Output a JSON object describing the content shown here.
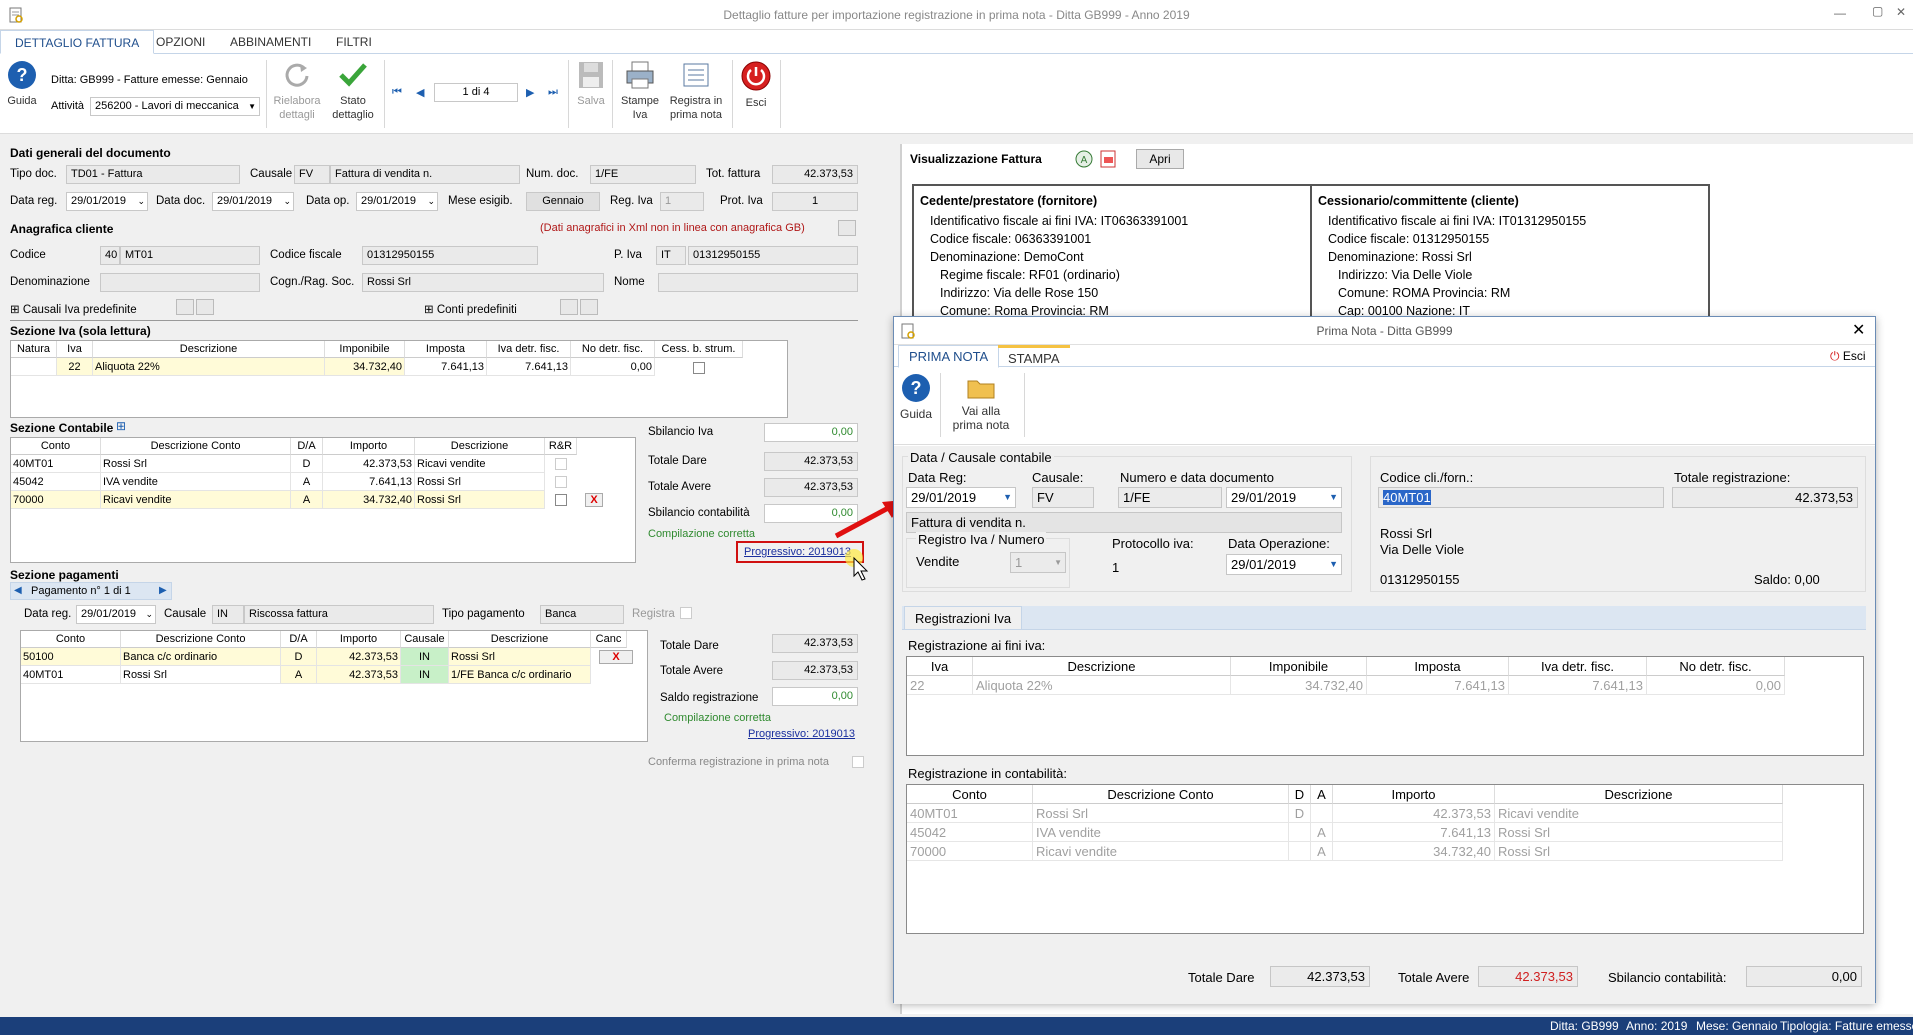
{
  "window": {
    "title": "Dettaglio fatture per importazione registrazione in prima nota - Ditta GB999 - Anno 2019",
    "min": "—",
    "max": "▢",
    "close": "✕"
  },
  "tabs": [
    "DETTAGLIO FATTURA",
    "OPZIONI",
    "ABBINAMENTI",
    "FILTRI"
  ],
  "ribbon": {
    "guida": "Guida",
    "ditta": "Ditta: GB999 - Fatture emesse: Gennaio",
    "attivita_label": "Attività",
    "attivita": "256200 - Lavori di meccanica",
    "rielabora": "Rielabora",
    "dettagli": "dettagli",
    "stato": "Stato",
    "dettaglio": "dettaglio",
    "page": "1 di 4",
    "salva": "Salva",
    "stampe": "Stampe",
    "iva": "Iva",
    "registra": "Registra in",
    "prima_nota": "prima nota",
    "esci": "Esci"
  },
  "dati": {
    "title": "Dati generali del documento",
    "tipo_doc_l": "Tipo doc.",
    "tipo_doc": "TD01 - Fattura",
    "causale_l": "Causale",
    "causale_code": "FV",
    "causale_desc": "Fattura di vendita n.",
    "num_doc_l": "Num. doc.",
    "num_doc": "1/FE",
    "tot_l": "Tot. fattura",
    "tot": "42.373,53",
    "data_reg_l": "Data reg.",
    "data_reg": "29/01/2019",
    "data_doc_l": "Data doc.",
    "data_doc": "29/01/2019",
    "data_op_l": "Data op.",
    "data_op": "29/01/2019",
    "mese_l": "Mese esigib.",
    "mese": "Gennaio",
    "reg_iva_l": "Reg. Iva",
    "reg_iva": "1",
    "prot_l": "Prot. Iva",
    "prot": "1"
  },
  "anagrafica": {
    "title": "Anagrafica cliente",
    "note": "(Dati anagrafici in Xml non in linea con anagrafica GB)",
    "codice_l": "Codice",
    "codice_n": "40",
    "codice": "MT01",
    "cf_l": "Codice fiscale",
    "cf": "01312950155",
    "piva_l": "P. Iva",
    "piva_c": "IT",
    "piva": "01312950155",
    "denom_l": "Denominazione",
    "cogn_l": "Cogn./Rag. Soc.",
    "cogn": "Rossi Srl",
    "nome_l": "Nome",
    "causali": "Causali Iva predefinite",
    "conti": "Conti predefiniti"
  },
  "iva": {
    "title": "Sezione Iva (sola lettura)",
    "headers": [
      "Natura",
      "Iva",
      "Descrizione",
      "Imponibile",
      "Imposta",
      "Iva detr. fisc.",
      "No detr. fisc.",
      "Cess. b. strum."
    ],
    "row": [
      "",
      "22",
      "Aliquota 22%",
      "34.732,40",
      "7.641,13",
      "7.641,13",
      "0,00"
    ]
  },
  "contabile": {
    "title": "Sezione Contabile",
    "plus": "⊞",
    "headers": [
      "Conto",
      "Descrizione Conto",
      "D/A",
      "Importo",
      "Descrizione",
      "R&R"
    ],
    "rows": [
      [
        "40MT01",
        "Rossi Srl",
        "D",
        "42.373,53",
        "Ricavi vendite"
      ],
      [
        "45042",
        "IVA vendite",
        "A",
        "7.641,13",
        "Rossi Srl"
      ],
      [
        "70000",
        "Ricavi vendite",
        "A",
        "34.732,40",
        "Rossi Srl"
      ]
    ],
    "sb_iva_l": "Sbilancio Iva",
    "sb_iva": "0,00",
    "tot_dare_l": "Totale Dare",
    "tot_dare": "42.373,53",
    "tot_avere_l": "Totale Avere",
    "tot_avere": "42.373,53",
    "sb_cont_l": "Sbilancio contabilità",
    "sb_cont": "0,00",
    "ok": "Compilazione corretta",
    "progressivo": "Progressivo: 2019013"
  },
  "pagamenti": {
    "title": "Sezione pagamenti",
    "nav": "Pagamento n° 1 di 1",
    "data_l": "Data reg.",
    "data": "29/01/2019",
    "causale_l": "Causale",
    "causale_code": "IN",
    "causale_desc": "Riscossa fattura",
    "tipo_l": "Tipo pagamento",
    "tipo": "Banca",
    "registra": "Registra",
    "headers": [
      "Conto",
      "Descrizione Conto",
      "D/A",
      "Importo",
      "Causale",
      "Descrizione",
      "Canc"
    ],
    "rows": [
      [
        "50100",
        "Banca c/c ordinario",
        "D",
        "42.373,53",
        "IN",
        "Rossi Srl"
      ],
      [
        "40MT01",
        "Rossi Srl",
        "A",
        "42.373,53",
        "IN",
        "1/FE Banca c/c ordinario"
      ]
    ],
    "tot_dare_l": "Totale Dare",
    "tot_dare": "42.373,53",
    "tot_avere_l": "Totale Avere",
    "tot_avere": "42.373,53",
    "saldo_l": "Saldo registrazione",
    "saldo": "0,00",
    "ok": "Compilazione corretta",
    "progressivo": "Progressivo: 2019013",
    "conferma": "Conferma registrazione in prima nota"
  },
  "viz": {
    "title": "Visualizzazione Fattura",
    "apri": "Apri",
    "ced_title": "Cedente/prestatore (fornitore)",
    "ced": [
      "Identificativo fiscale ai fini IVA: IT06363391001",
      "Codice fiscale: 06363391001",
      "Denominazione: DemoCont",
      "Regime fiscale: RF01 (ordinario)",
      "Indirizzo: Via delle Rose 150",
      "Comune: Roma Provincia: RM"
    ],
    "ces_title": "Cessionario/committente (cliente)",
    "ces": [
      "Identificativo fiscale ai fini IVA: IT01312950155",
      "Codice fiscale: 01312950155",
      "Denominazione: Rossi Srl",
      "Indirizzo: Via Delle Viole",
      "Comune: ROMA Provincia: RM",
      "Cap: 00100 Nazione: IT"
    ]
  },
  "dialog": {
    "title": "Prima Nota - Ditta GB999",
    "tabs": [
      "PRIMA NOTA",
      "STAMPA"
    ],
    "esci": "Esci",
    "guida": "Guida",
    "vai": "Vai alla",
    "vai2": "prima nota",
    "grp_title": "Data / Causale contabile",
    "data_reg_l": "Data Reg:",
    "data_reg": "29/01/2019",
    "causale_l": "Causale:",
    "causale": "FV",
    "num_l": "Numero e data documento",
    "num": "1/FE",
    "num_data": "29/01/2019",
    "causale_desc": "Fattura di vendita n.",
    "reg_iva_l": "Registro Iva / Numero",
    "reg_iva": "Vendite",
    "reg_num": "1",
    "prot_l": "Protocollo iva:",
    "prot": "1",
    "data_op_l": "Data Operazione:",
    "data_op": "29/01/2019",
    "cod_l": "Codice cli./forn.:",
    "cod": "40MT01",
    "tot_reg_l": "Totale registrazione:",
    "tot_reg": "42.373,53",
    "cli_nome": "Rossi Srl",
    "cli_via": "Via Delle Viole",
    "cli_cf": "01312950155",
    "saldo": "Saldo: 0,00",
    "reg_tab": "Registrazioni Iva",
    "reg_iva_title": "Registrazione ai fini iva:",
    "iva_headers": [
      "Iva",
      "Descrizione",
      "Imponibile",
      "Imposta",
      "Iva detr. fisc.",
      "No detr. fisc."
    ],
    "iva_row": [
      "22",
      "Aliquota 22%",
      "34.732,40",
      "7.641,13",
      "7.641,13",
      "0,00"
    ],
    "cont_title": "Registrazione in contabilità:",
    "cont_headers": [
      "Conto",
      "Descrizione Conto",
      "D",
      "A",
      "Importo",
      "Descrizione"
    ],
    "cont_rows": [
      [
        "40MT01",
        "Rossi Srl",
        "D",
        "",
        "42.373,53",
        "Ricavi vendite"
      ],
      [
        "45042",
        "IVA vendite",
        "",
        "A",
        "7.641,13",
        "Rossi Srl"
      ],
      [
        "70000",
        "Ricavi vendite",
        "",
        "A",
        "34.732,40",
        "Rossi Srl"
      ]
    ],
    "tot_dare_l": "Totale Dare",
    "tot_dare": "42.373,53",
    "tot_avere_l": "Totale Avere",
    "tot_avere": "42.373,53",
    "sb_l": "Sbilancio contabilità:",
    "sb": "0,00"
  },
  "status": {
    "ditta": "Ditta: GB999",
    "anno": "Anno: 2019",
    "mese": "Mese: Gennaio",
    "tipologia": "Tipologia: Fatture emesse"
  }
}
